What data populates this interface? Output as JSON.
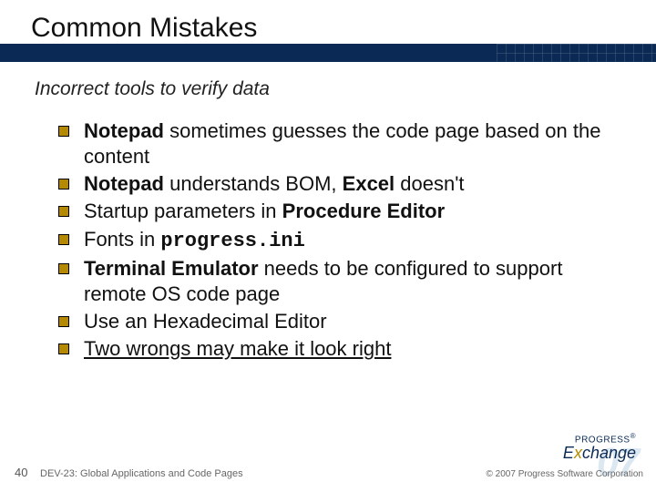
{
  "slide": {
    "title": "Common Mistakes",
    "subtitle": "Incorrect tools to verify data",
    "page_number": "40",
    "footer_title": "DEV-23: Global Applications and Code Pages",
    "copyright": "© 2007 Progress Software Corporation"
  },
  "bullets": [
    {
      "html": "<b>Notepad</b> sometimes guesses the code page based on the content"
    },
    {
      "html": "<b>Notepad</b> understands BOM, <b>Excel</b> doesn't"
    },
    {
      "html": "Startup parameters in <b>Procedure Editor</b>"
    },
    {
      "html": "Fonts in <span class='mono'><b>progress.ini</b></span>"
    },
    {
      "html": "<b>Terminal Emulator</b> needs to be configured to support remote OS code page"
    },
    {
      "html": "Use an Hexadecimal Editor"
    },
    {
      "html": "<span class='underline'>Two wrongs may make it look right</span>"
    }
  ],
  "logo": {
    "line1": "PROGRESS",
    "reg": "®",
    "line2_pre": "E",
    "line2_x": "x",
    "line2_post": "change",
    "watermark": "07"
  }
}
